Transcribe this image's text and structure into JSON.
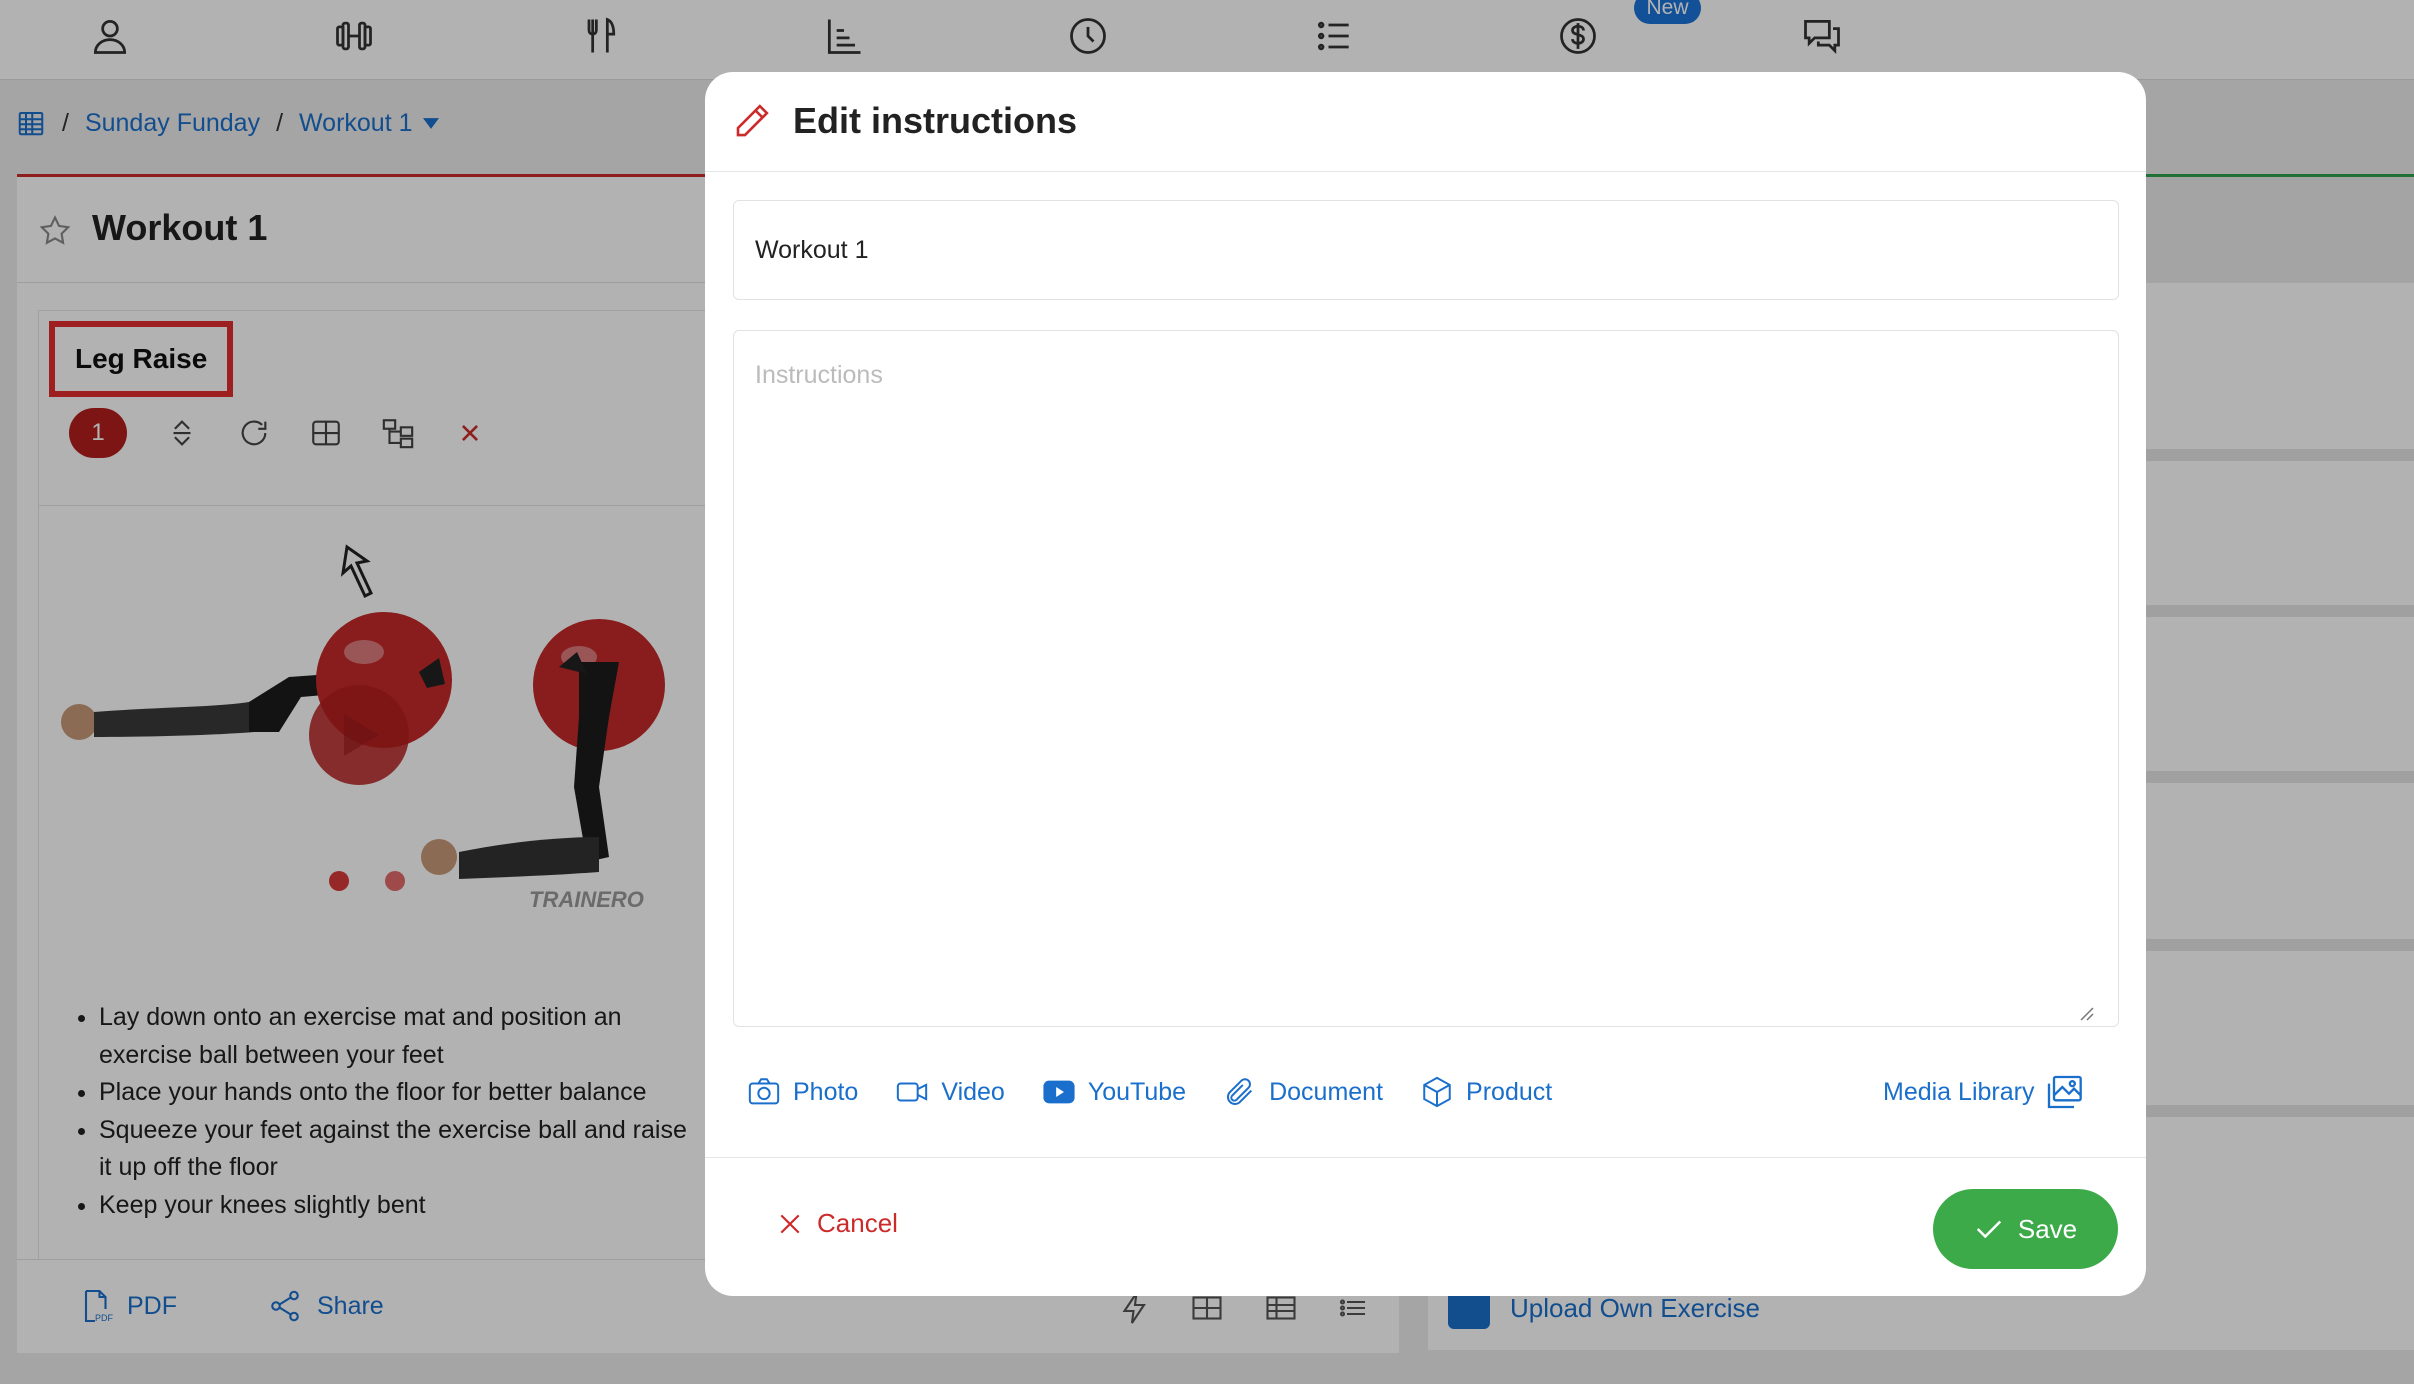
{
  "nav": {
    "items": [
      {
        "name": "profile",
        "icon": "user-icon"
      },
      {
        "name": "workouts",
        "icon": "dumbbell-icon"
      },
      {
        "name": "nutrition",
        "icon": "fork-knife-icon"
      },
      {
        "name": "progress",
        "icon": "chart-icon"
      },
      {
        "name": "history",
        "icon": "clock-icon"
      },
      {
        "name": "lists",
        "icon": "list-icon"
      },
      {
        "name": "billing",
        "icon": "dollar-icon"
      },
      {
        "name": "messages",
        "icon": "chat-icon"
      }
    ],
    "new_badge": "New"
  },
  "breadcrumb": {
    "separator": "/",
    "program": "Sunday Funday",
    "current": "Workout 1"
  },
  "workout": {
    "title": "Workout 1",
    "exercise": {
      "name": "Leg Raise",
      "set_number": "1",
      "watermark": "TRAINERO",
      "steps": [
        "Lay down onto an exercise mat and position an exercise ball between your feet",
        "Place your hands onto the floor for better balance",
        "Squeeze your feet against the exercise ball and raise it up off the floor",
        "Keep your knees slightly bent"
      ]
    },
    "footer": {
      "pdf_label": "PDF",
      "share_label": "Share"
    }
  },
  "right_panel": {
    "upload_label": "Upload Own Exercise"
  },
  "modal": {
    "title": "Edit instructions",
    "name_value": "Workout 1",
    "instructions_placeholder": "Instructions",
    "attachments": [
      {
        "label": "Photo",
        "icon": "camera-icon"
      },
      {
        "label": "Video",
        "icon": "video-icon"
      },
      {
        "label": "YouTube",
        "icon": "youtube-icon"
      },
      {
        "label": "Document",
        "icon": "paperclip-icon"
      },
      {
        "label": "Product",
        "icon": "box-icon"
      }
    ],
    "media_library_label": "Media Library",
    "cancel_label": "Cancel",
    "save_label": "Save"
  },
  "colors": {
    "link": "#1a6fcc",
    "danger": "#cc2b2b",
    "success": "#3daa4a",
    "badge": "#1a73d9"
  }
}
